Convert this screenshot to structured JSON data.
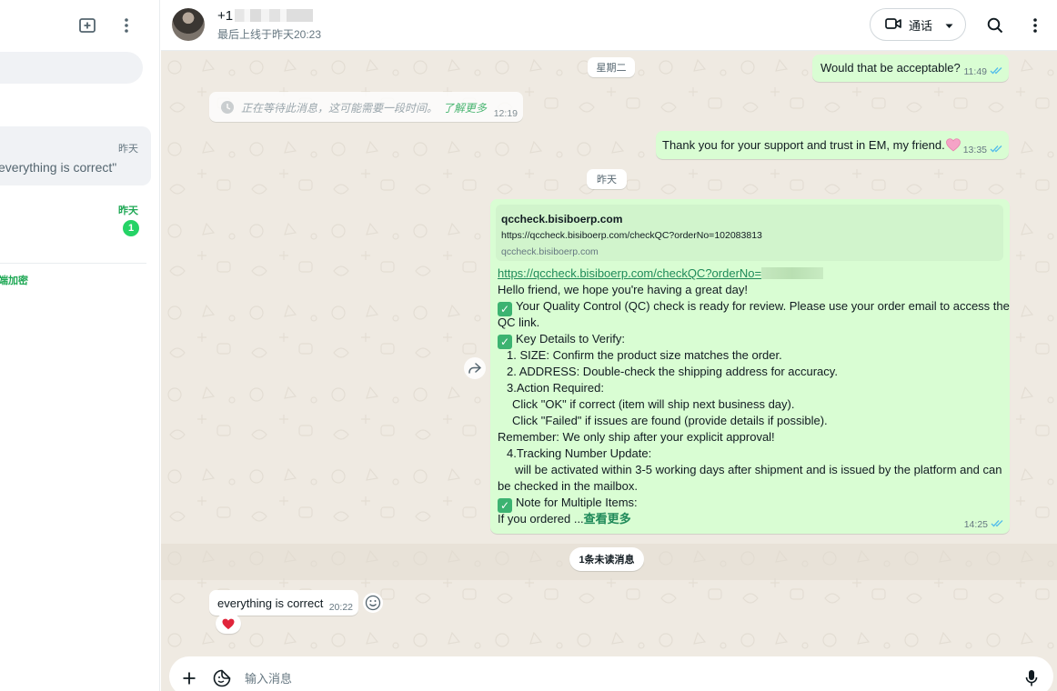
{
  "left_panel": {
    "chats": [
      {
        "time": "昨天",
        "preview": "everything is correct\""
      },
      {
        "time": "昨天",
        "unread_count": "1"
      }
    ],
    "encryption_note": "端加密"
  },
  "header": {
    "name_visible": "+1",
    "last_seen": "最后上线于昨天20:23",
    "call_label": "通话"
  },
  "messages": {
    "date_tuesday": "星期二",
    "msg1": {
      "text": "Would that be acceptable?",
      "time": "11:49"
    },
    "waiting": {
      "text": "正在等待此消息，这可能需要一段时间。",
      "link": "了解更多",
      "time": "12:19"
    },
    "msg2": {
      "text": "Thank you for your support and trust in EM, my friend.",
      "time": "13:35"
    },
    "date_yesterday": "昨天",
    "qc": {
      "preview_title": "qccheck.bisiboerp.com",
      "preview_url": "https://qccheck.bisiboerp.com/checkQC?orderNo=102083813",
      "preview_domain": "qccheck.bisiboerp.com",
      "link_text": "https://qccheck.bisiboerp.com/checkQC?orderNo=",
      "l1": "Hello friend, we hope you're having a great day!",
      "l2": "Your Quality Control (QC) check is ready for review. Please use your order email to access the",
      "l3": "QC link.",
      "l4": "Key Details to Verify:",
      "l5": "1. SIZE: Confirm the product size matches the order.",
      "l6": "2. ADDRESS: Double-check the shipping address for accuracy.",
      "l7": "3.Action Required:",
      "l8": "Click \"OK\" if correct (item will ship next business day).",
      "l9": "Click \"Failed\" if issues are found (provide details if possible).",
      "l10": "Remember: We only ship after your explicit approval!",
      "l11": "4.Tracking Number Update:",
      "l12": "will be activated within 3-5 working days after shipment and is issued by the platform and can",
      "l13": "be checked in the mailbox.",
      "l14": "Note for Multiple Items:",
      "l15": "If you ordered ...",
      "read_more": "查看更多",
      "time": "14:25"
    },
    "unread_label": "1条未读消息",
    "incoming": {
      "text": "everything is correct",
      "time": "20:22"
    }
  },
  "compose": {
    "placeholder": "输入消息"
  },
  "colors": {
    "outgoing_bubble": "#d9fdd3",
    "chat_bg": "#efeae2",
    "accent_green": "#1fa855",
    "read_tick": "#53bdeb"
  }
}
